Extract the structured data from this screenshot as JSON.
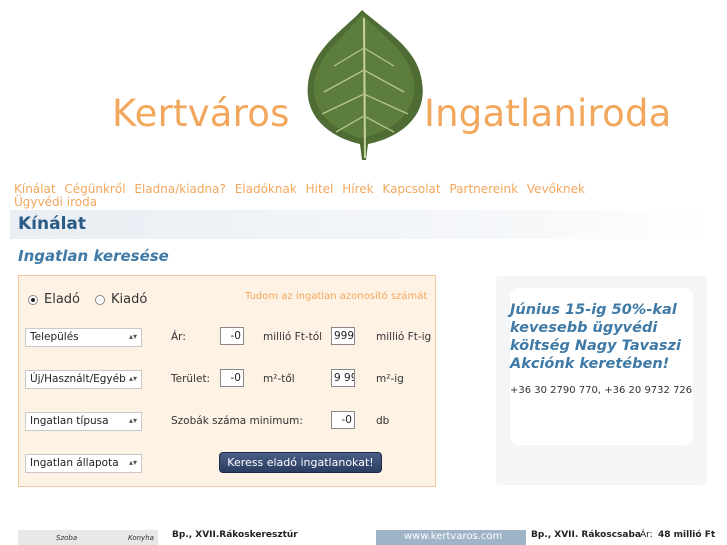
{
  "header": {
    "brand_left": "Kertváros",
    "brand_right": "Ingatlaniroda",
    "brand_color": "#f3a75d"
  },
  "nav": {
    "items": [
      "Kínálat",
      "Cégünkről",
      "Eladna/kiadna?",
      "Eladóknak",
      "Hitel",
      "Hírek",
      "Kapcsolat",
      "Partnereink",
      "Vevőknek",
      "Ügyvédi iroda"
    ]
  },
  "section": {
    "title": "Kínálat"
  },
  "search": {
    "title": "Ingatlan keresése",
    "radio_sale": "Eladó",
    "radio_rent": "Kiadó",
    "id_link": "Tudom az ingatlan azonosító számát",
    "select_city": "Település",
    "select_condition_type": "Új/Használt/Egyéb",
    "select_type": "Ingatlan típusa",
    "select_state": "Ingatlan állapota",
    "price_label": "Ár:",
    "price_from": "-0",
    "price_from_unit": "millió Ft-tól",
    "price_to": "999",
    "price_to_unit": "millió Ft-ig",
    "area_label": "Terület:",
    "area_from": "-0",
    "area_from_unit": "m²-től",
    "area_to": "9 99",
    "area_to_unit": "m²-ig",
    "rooms_label": "Szobák száma minimum:",
    "rooms_value": "-0",
    "rooms_unit": "db",
    "submit": "Keress eladó ingatlanokat!"
  },
  "promo": {
    "headline": "Június 15-ig 50%-kal kevesebb ügyvédi költség Nagy Tavaszi Akciónk keretében!",
    "phone": "+36 30 2790 770, +36 20 9732 726"
  },
  "listings": [
    {
      "location": "Bp., XVII.Rákoskeresztúr",
      "image_words": [
        "Szoba",
        "Konyha"
      ]
    },
    {
      "location": "Bp., XVII. Rákoscsaba",
      "price_label": "Ár:",
      "price": "48 millió Ft",
      "image_text": "www.kertvaros.com"
    }
  ],
  "icons": [
    "leaf-logo",
    "select-arrow-icon"
  ]
}
